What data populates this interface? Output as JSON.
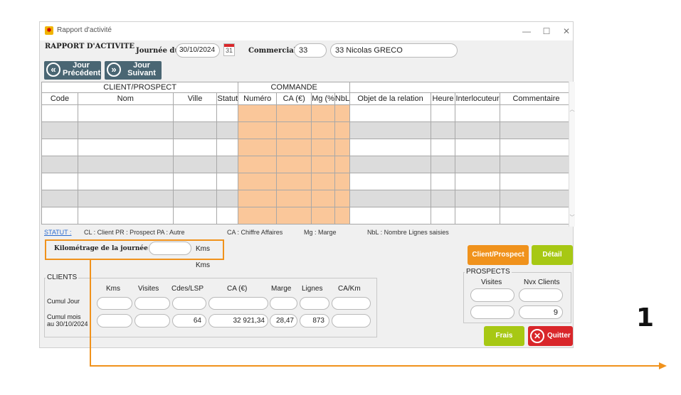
{
  "window": {
    "title": "Rapport d'activité",
    "app_icon": "app-calendar-icon"
  },
  "header": {
    "report_title": "RAPPORT D'ACTIVITE",
    "journee_label": "Journée du",
    "date_value": "30/10/2024",
    "calendar_day": "31",
    "commercial_label": "Commercial",
    "commercial_code": "33",
    "commercial_name": "33 Nicolas GRECO"
  },
  "nav": {
    "prev_line1": "Jour",
    "prev_line2": "Précédent",
    "next_line1": "Jour",
    "next_line2": "Suivant"
  },
  "table": {
    "group_client": "CLIENT/PROSPECT",
    "group_commande": "COMMANDE",
    "columns": [
      "Code",
      "Nom",
      "Ville",
      "Statut",
      "Numéro",
      "CA (€)",
      "Mg (%",
      "NbL",
      "Objet de la relation",
      "Heure",
      "Interlocuteur",
      "Commentaire"
    ]
  },
  "legend": {
    "statut_link": "STATUT :",
    "statut_text": "CL : Client  PR : Prospect  PA : Autre",
    "ca": "CA : Chiffre Affaires",
    "mg": "Mg : Marge",
    "nbl": "NbL : Nombre Lignes saisies"
  },
  "km": {
    "label": "Kilométrage de la journée",
    "value": "",
    "unit": "Kms",
    "unit2": "Kms"
  },
  "clients": {
    "group_label": "CLIENTS",
    "headers": [
      "Kms",
      "Visites",
      "Cdes/LSP",
      "CA (€)",
      "Marge",
      "Lignes",
      "CA/Km"
    ],
    "row1_label": "Cumul Jour",
    "row2_label_line1": "Cumul mois",
    "row2_label_line2": "au 30/10/2024",
    "row1": [
      "",
      "",
      "",
      "",
      "",
      "",
      ""
    ],
    "row2": [
      "",
      "",
      "64",
      "32 921,34",
      "28,47",
      "873",
      ""
    ]
  },
  "prospects": {
    "group_label": "PROSPECTS",
    "headers": [
      "Visites",
      "Nvx Clients"
    ],
    "row1": [
      "",
      ""
    ],
    "row2": [
      "",
      "9"
    ]
  },
  "buttons": {
    "client_prospect": "Client/Prospect",
    "detail": "Détail",
    "frais": "Frais",
    "quitter": "Quitter"
  },
  "annotation": {
    "step_number": "1"
  },
  "colors": {
    "orange_accent": "#f0921c",
    "commande_fill": "#fac79a",
    "green": "#a7c814",
    "red": "#d9262a",
    "nav_blue": "#4a6673"
  }
}
